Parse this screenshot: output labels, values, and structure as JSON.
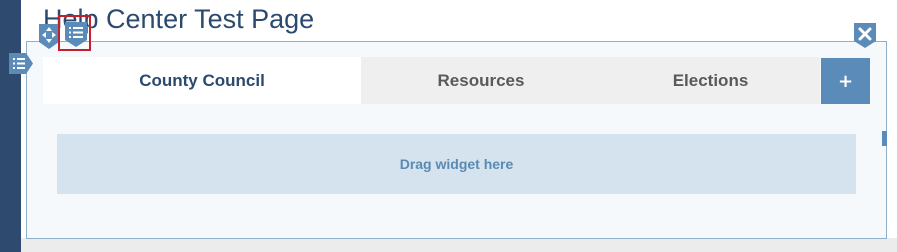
{
  "page": {
    "title": "Help Center Test Page"
  },
  "tabs": [
    {
      "label": "County Council",
      "active": true
    },
    {
      "label": "Resources",
      "active": false
    },
    {
      "label": "Elections",
      "active": false
    }
  ],
  "add_tab": {
    "label": "+"
  },
  "drop_zone": {
    "label": "Drag widget here"
  },
  "icons": {
    "move": "move-arrows-icon",
    "list": "list-icon",
    "close": "close-icon",
    "section_list": "list-icon"
  },
  "colors": {
    "rail": "#2e4a6f",
    "accent": "#5b8bb8",
    "title": "#2b4a6e",
    "highlight": "#c21f2f",
    "drop_zone_bg": "#d5e3ee"
  }
}
